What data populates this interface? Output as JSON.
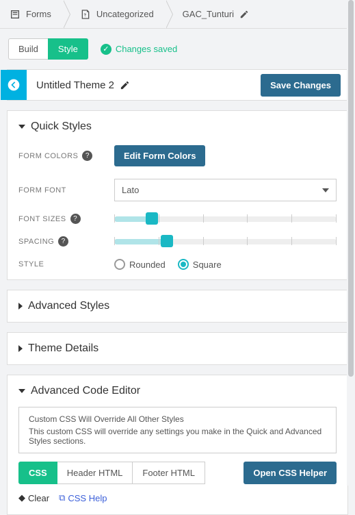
{
  "breadcrumb": {
    "forms": "Forms",
    "uncategorized": "Uncategorized",
    "name": "GAC_Tunturi"
  },
  "tabs": {
    "build": "Build",
    "style": "Style"
  },
  "saved_label": "Changes saved",
  "title": "Untitled Theme 2",
  "save_button": "Save Changes",
  "quick": {
    "heading": "Quick Styles",
    "form_colors_label": "FORM COLORS",
    "edit_colors_button": "Edit Form Colors",
    "form_font_label": "FORM FONT",
    "font_value": "Lato",
    "font_sizes_label": "FONT SIZES",
    "spacing_label": "SPACING",
    "style_label": "STYLE",
    "rounded": "Rounded",
    "square": "Square"
  },
  "advanced_styles_heading": "Advanced Styles",
  "theme_details_heading": "Theme Details",
  "advcode": {
    "heading": "Advanced Code Editor",
    "note_title": "Custom CSS Will Override All Other Styles",
    "note_body": "This custom CSS will override any settings you make in the Quick and Advanced Styles sections.",
    "tab_css": "CSS",
    "tab_header": "Header HTML",
    "tab_footer": "Footer HTML",
    "open_helper": "Open CSS Helper",
    "clear": "Clear",
    "css_help": "CSS Help"
  }
}
